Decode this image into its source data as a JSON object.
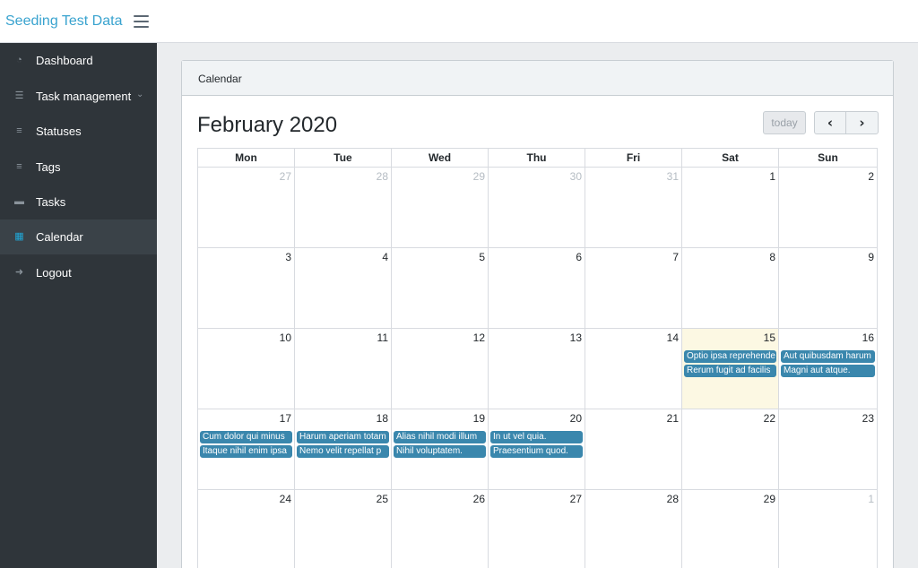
{
  "brand": "Seeding Test Data",
  "sidebar": {
    "items": [
      {
        "label": "Dashboard",
        "icon": "dashboard-icon"
      },
      {
        "label": "Task management",
        "icon": "list-icon",
        "has_children": true
      },
      {
        "label": "Statuses",
        "icon": "server-icon"
      },
      {
        "label": "Tags",
        "icon": "server-icon"
      },
      {
        "label": "Tasks",
        "icon": "briefcase-icon"
      },
      {
        "label": "Calendar",
        "icon": "calendar-icon",
        "active": true
      },
      {
        "label": "Logout",
        "icon": "sign-out-icon"
      }
    ]
  },
  "card": {
    "title": "Calendar"
  },
  "calendar": {
    "title": "February 2020",
    "today_label": "today",
    "prev_label": "‹",
    "next_label": "›",
    "weekdays": [
      "Mon",
      "Tue",
      "Wed",
      "Thu",
      "Fri",
      "Sat",
      "Sun"
    ],
    "weeks": [
      [
        {
          "day": "27",
          "other": true
        },
        {
          "day": "28",
          "other": true
        },
        {
          "day": "29",
          "other": true
        },
        {
          "day": "30",
          "other": true
        },
        {
          "day": "31",
          "other": true
        },
        {
          "day": "1"
        },
        {
          "day": "2"
        }
      ],
      [
        {
          "day": "3"
        },
        {
          "day": "4"
        },
        {
          "day": "5"
        },
        {
          "day": "6"
        },
        {
          "day": "7"
        },
        {
          "day": "8"
        },
        {
          "day": "9"
        }
      ],
      [
        {
          "day": "10"
        },
        {
          "day": "11"
        },
        {
          "day": "12"
        },
        {
          "day": "13"
        },
        {
          "day": "14"
        },
        {
          "day": "15",
          "today": true,
          "events": [
            "Optio ipsa reprehenderit",
            "Rerum fugit ad facilis"
          ]
        },
        {
          "day": "16",
          "events": [
            "Aut quibusdam harum",
            "Magni aut atque."
          ]
        }
      ],
      [
        {
          "day": "17",
          "events": [
            "Cum dolor qui minus",
            "Itaque nihil enim ipsa"
          ]
        },
        {
          "day": "18",
          "events": [
            "Harum aperiam totam",
            "Nemo velit repellat p"
          ]
        },
        {
          "day": "19",
          "events": [
            "Alias nihil modi illum",
            "Nihil voluptatem."
          ]
        },
        {
          "day": "20",
          "events": [
            "In ut vel quia.",
            "Praesentium quod."
          ]
        },
        {
          "day": "21"
        },
        {
          "day": "22"
        },
        {
          "day": "23"
        }
      ],
      [
        {
          "day": "24"
        },
        {
          "day": "25"
        },
        {
          "day": "26"
        },
        {
          "day": "27"
        },
        {
          "day": "28"
        },
        {
          "day": "29"
        },
        {
          "day": "1",
          "other": true
        }
      ]
    ]
  },
  "colors": {
    "accent": "#20a8d8",
    "brand": "#39a3cf",
    "event": "#3a87ad",
    "today_bg": "#fcf8e3",
    "sidebar_bg": "#2f353a"
  }
}
